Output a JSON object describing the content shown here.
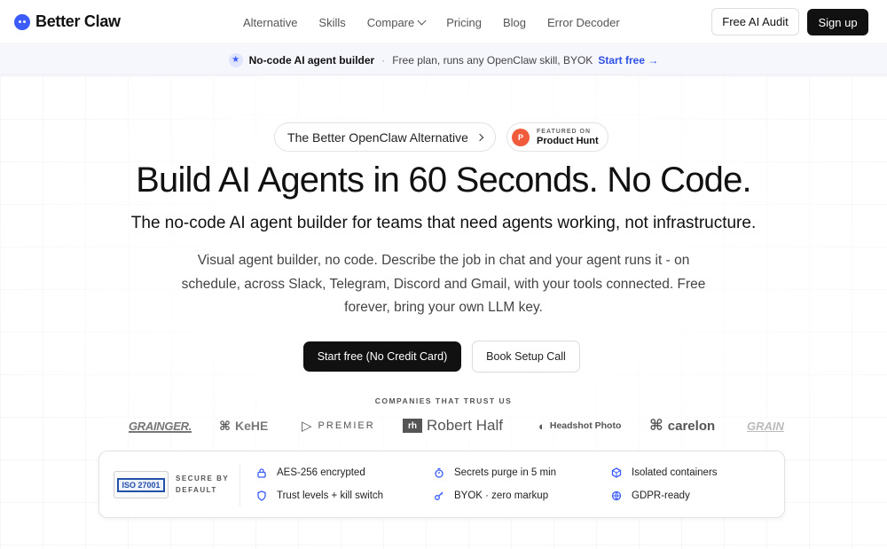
{
  "header": {
    "brand": "Better Claw",
    "nav": [
      "Alternative",
      "Skills",
      "Compare",
      "Pricing",
      "Blog",
      "Error Decoder"
    ],
    "audit_button": "Free AI Audit",
    "signup_button": "Sign up"
  },
  "banner": {
    "headline": "No-code AI agent builder",
    "separator": "·",
    "text": "Free plan, runs any OpenClaw skill, BYOK",
    "link": "Start free →"
  },
  "pills": {
    "alternative": "The Better OpenClaw Alternative",
    "product_hunt_small": "FEATURED ON",
    "product_hunt_name": "Product Hunt",
    "product_hunt_letter": "P"
  },
  "hero": {
    "title": "Build AI Agents in 60 Seconds. No Code.",
    "subtitle": "The no-code AI agent builder for teams that need agents working, not infrastructure.",
    "description": "Visual agent builder, no code. Describe the job in chat and your agent runs it - on schedule, across Slack, Telegram, Discord and Gmail, with your tools connected. Free forever, bring your own LLM key.",
    "cta_primary": "Start free (No Credit Card)",
    "cta_secondary": "Book Setup Call"
  },
  "trust": {
    "label": "COMPANIES THAT TRUST US",
    "companies": [
      "GRAINGER.",
      "KeHE",
      "PREMIER",
      "Robert Half",
      "Headshot Photo",
      "carelon",
      "GRAIN"
    ],
    "robert_half_mark": "rh"
  },
  "security": {
    "iso_label": "ISO 27001",
    "label_line1": "SECURE BY",
    "label_line2": "DEFAULT",
    "features": [
      "AES-256 encrypted",
      "Trust levels + kill switch",
      "Secrets purge in 5 min",
      "BYOK · zero markup",
      "Isolated containers",
      "GDPR-ready"
    ]
  },
  "colors": {
    "accent": "#3b5bfd",
    "link": "#2f50e6",
    "dark_button": "#111111",
    "product_hunt": "#ef5b3b"
  }
}
